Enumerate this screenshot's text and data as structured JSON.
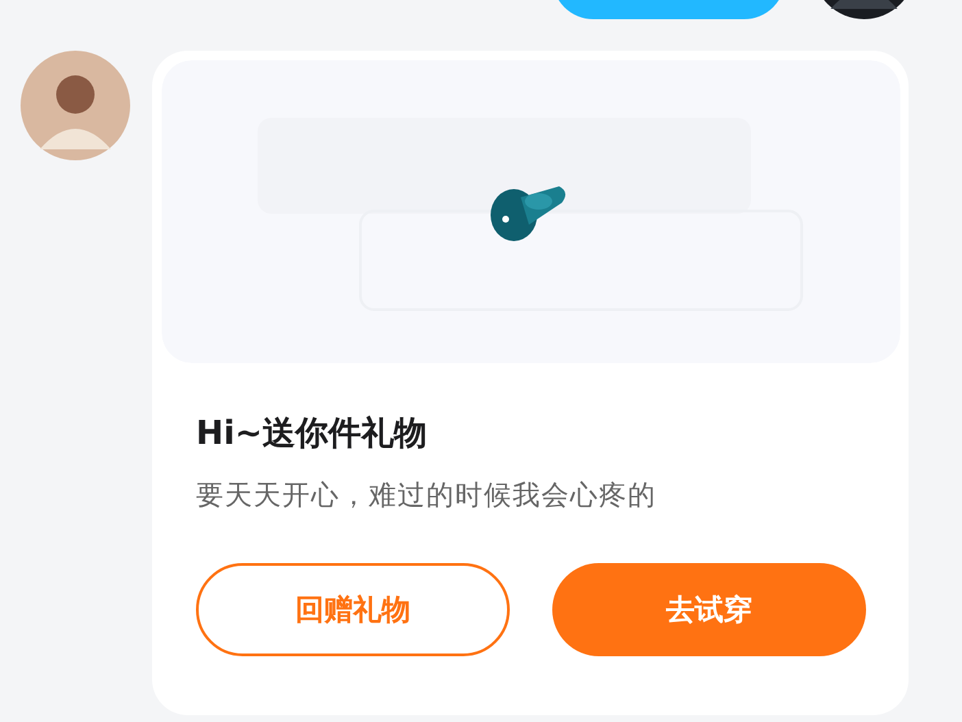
{
  "gift_card": {
    "title": "Hi~送你件礼物",
    "message": "要天天开心，难过的时候我会心疼的",
    "buttons": [
      {
        "label": "回赠礼物",
        "kind": "outline"
      },
      {
        "label": "去试穿",
        "kind": "filled"
      }
    ]
  }
}
